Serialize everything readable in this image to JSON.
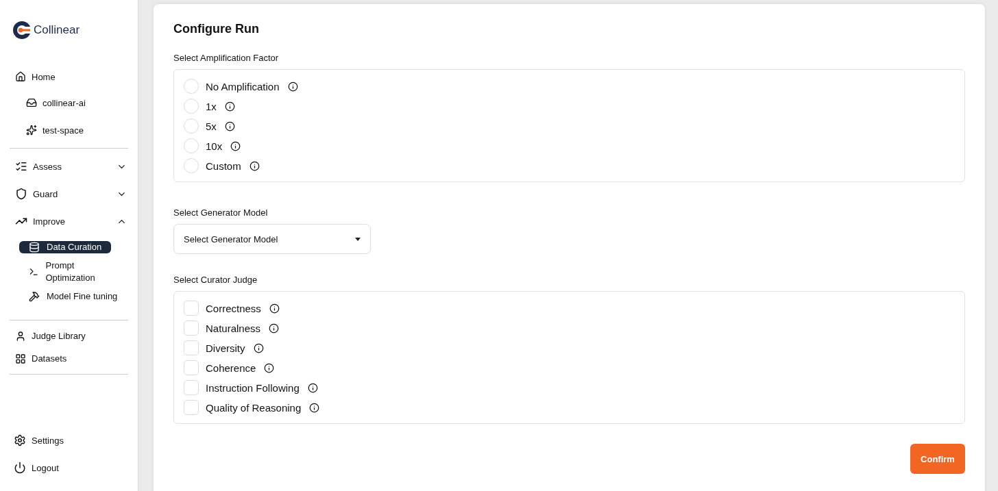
{
  "sidebar": {
    "logo": "Collinear",
    "home": {
      "label": "Home",
      "children": [
        {
          "label": "collinear-ai"
        },
        {
          "label": "test-space"
        }
      ]
    },
    "sections": [
      {
        "label": "Assess",
        "expanded": false
      },
      {
        "label": "Guard",
        "expanded": false
      },
      {
        "label": "Improve",
        "expanded": true,
        "children": [
          {
            "label": "Data Curation",
            "selected": true
          },
          {
            "label": "Prompt Optimization",
            "selected": false
          },
          {
            "label": "Model Fine tuning",
            "selected": false
          }
        ]
      }
    ],
    "library": [
      {
        "label": "Judge Library"
      },
      {
        "label": "Datasets"
      }
    ],
    "footer": [
      {
        "label": "Settings"
      },
      {
        "label": "Logout"
      }
    ]
  },
  "main": {
    "title": "Configure Run",
    "amplification": {
      "label": "Select Amplification Factor",
      "options": [
        {
          "label": "No Amplification",
          "selected": false
        },
        {
          "label": "1x",
          "selected": false
        },
        {
          "label": "5x",
          "selected": false
        },
        {
          "label": "10x",
          "selected": false
        },
        {
          "label": "Custom",
          "selected": false
        }
      ]
    },
    "generator": {
      "label": "Select Generator Model",
      "placeholder": "Select Generator Model"
    },
    "judge": {
      "label": "Select Curator Judge",
      "options": [
        {
          "label": "Correctness",
          "checked": false
        },
        {
          "label": "Naturalness",
          "checked": false
        },
        {
          "label": "Diversity",
          "checked": false
        },
        {
          "label": "Coherence",
          "checked": false
        },
        {
          "label": "Instruction Following",
          "checked": false
        },
        {
          "label": "Quality of Reasoning",
          "checked": false
        }
      ]
    },
    "confirm": "Confirm"
  }
}
